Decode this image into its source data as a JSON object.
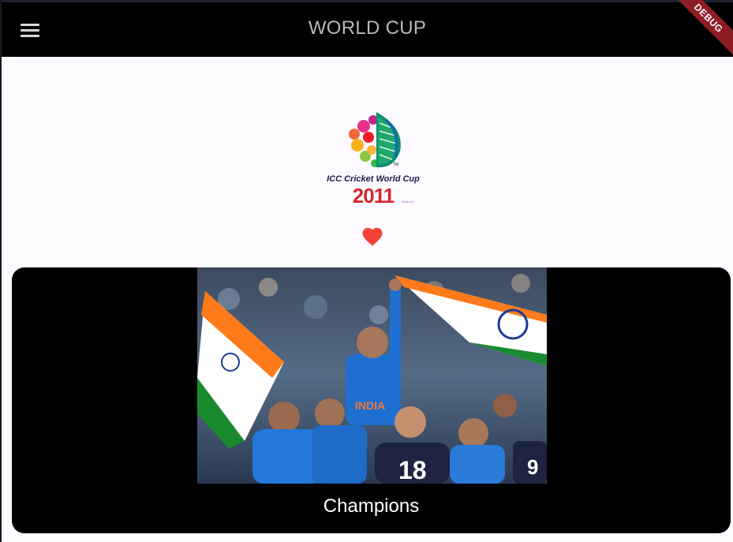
{
  "appbar": {
    "title": "WORLD CUP",
    "menu_icon": "hamburger-menu-icon",
    "debug_label": "DEBUG",
    "background": "#000000"
  },
  "logo": {
    "line1": "ICC Cricket World Cup",
    "year": "2011",
    "tm": "TM",
    "small": "Subs.Co"
  },
  "favorite": {
    "icon": "heart-icon",
    "color": "#f44336"
  },
  "card": {
    "caption": "Champions",
    "image": "team-celebration-photo"
  }
}
